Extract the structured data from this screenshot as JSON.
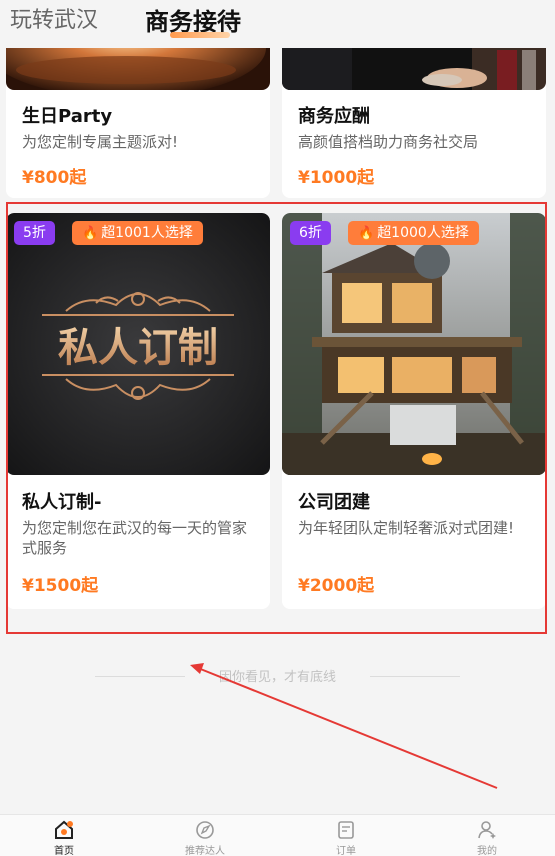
{
  "tabs": {
    "tab1": "玩转武汉",
    "tab2": "商务接待"
  },
  "cards": [
    {
      "title": "生日Party",
      "desc": "为您定制专属主题派对!",
      "price": "¥800起"
    },
    {
      "title": "商务应酬",
      "desc": "高颜值搭档助力商务社交局",
      "price": "¥1000起"
    },
    {
      "discount": "5折",
      "hot": "超1001人选择",
      "image_text": "私人订制",
      "title": "私人订制-",
      "desc": "为您定制您在武汉的每一天的管家式服务",
      "price": "¥1500起"
    },
    {
      "discount": "6折",
      "hot": "超1000人选择",
      "title": "公司团建",
      "desc": "为年轻团队定制轻奢派对式团建!",
      "price": "¥2000起"
    }
  ],
  "footer_hint": "因你看见，才有底线",
  "nav": [
    {
      "label": "首页",
      "icon": "home-icon",
      "active": true
    },
    {
      "label": "推荐达人",
      "icon": "compass-icon"
    },
    {
      "label": "订单",
      "icon": "order-icon"
    },
    {
      "label": "我的",
      "icon": "user-icon"
    }
  ],
  "colors": {
    "accent": "#ff7a22",
    "discount_badge": "#8a3cf0",
    "hot_badge": "#ff7d3a",
    "highlight_box": "#e53935"
  }
}
